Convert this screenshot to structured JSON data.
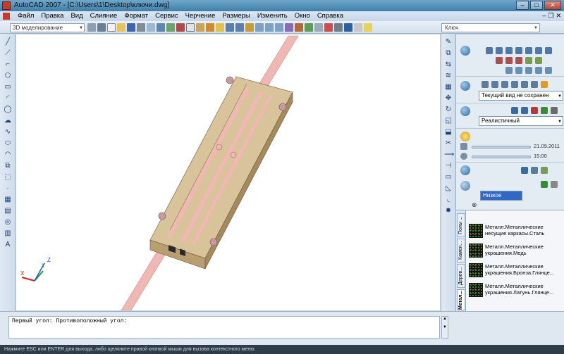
{
  "window": {
    "title": "AutoCAD 2007 - [C:\\Users\\1\\Desktop\\ключи.dwg]"
  },
  "menu": {
    "items": [
      "Файл",
      "Правка",
      "Вид",
      "Слияние",
      "Формат",
      "Сервис",
      "Черчение",
      "Размеры",
      "Изменить",
      "Окно",
      "Справка"
    ]
  },
  "toolbar": {
    "workspace": "3D моделирование",
    "layer": "Ключ"
  },
  "dashboard": {
    "view_combo": "Текущий вид не сохранен",
    "visual_style": "Реалистичный",
    "date": "21.09.2011",
    "time": "15:00",
    "quality": "Низкое"
  },
  "palette": {
    "tabs": [
      "Полы ...",
      "Камен...",
      "Дерев...",
      "Метал..."
    ],
    "materials": [
      "Металл.Металлические несущие каркасы.Сталь",
      "Металл.Металлические украшения.Медь",
      "Металл.Металлические украшения.Бронза.Глянце...",
      "Металл.Металлические украшения.Латунь.Глянце..."
    ]
  },
  "ucs": {
    "x": "X",
    "y": "Y",
    "z": "Z"
  },
  "command": {
    "line1": "Первый угол: Противоположный угол:"
  },
  "status": {
    "hint": "Нажмите ESC или ENTER для выхода, либо щелкните правой кнопкой мыши для вызова контекстного меню."
  },
  "colors": {
    "wood": "#d9c39a",
    "rod": "#f0b8b2",
    "title_bar": "#4f8fbc"
  }
}
